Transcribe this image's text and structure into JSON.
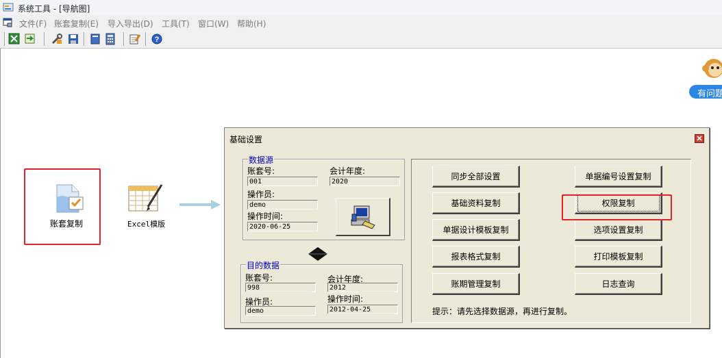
{
  "window": {
    "title": "系统工具 - [导航图]"
  },
  "menu": [
    "文件(F)",
    "账套复制(E)",
    "导入导出(D)",
    "工具(T)",
    "窗口(W)",
    "帮助(H)"
  ],
  "help_badge": {
    "text": "有问题"
  },
  "nav": {
    "account_copy_label": "账套复制",
    "excel_template_label": "Excel模版"
  },
  "dialog": {
    "title": "基础设置",
    "source": {
      "group_title": "数据源",
      "account_no_label": "账套号:",
      "account_no": "001",
      "year_label": "会计年度:",
      "year": "2020",
      "operator_label": "操作员:",
      "operator": "demo",
      "time_label": "操作时间:",
      "time": "2020-06-25"
    },
    "target": {
      "group_title": "目的数据",
      "account_no_label": "账套号:",
      "account_no": "998",
      "year_label": "会计年度:",
      "year": "2012",
      "operator_label": "操作员:",
      "operator": "demo",
      "time_label": "操作时间:",
      "time": "2012-04-25"
    },
    "buttons_left": [
      "同步全部设置",
      "基础资料复制",
      "单据设计模板复制",
      "报表格式复制",
      "账期管理复制"
    ],
    "buttons_right": [
      "单据编号设置复制",
      "权限复制",
      "选项设置复制",
      "打印模板复制",
      "日志查询"
    ],
    "hint": "提示：请先选择数据源，再进行复制。"
  }
}
